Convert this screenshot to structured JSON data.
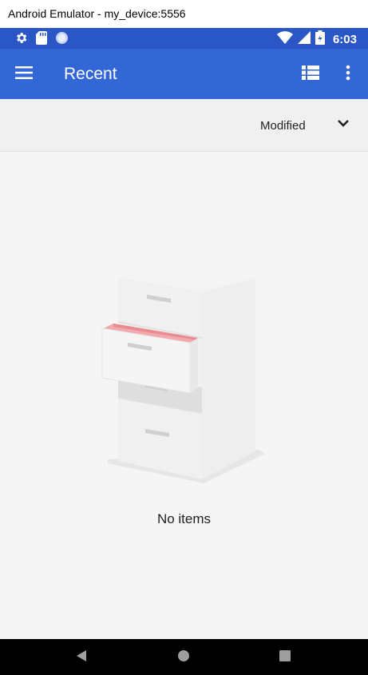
{
  "window": {
    "title": "Android Emulator - my_device:5556"
  },
  "status_bar": {
    "time": "6:03",
    "left_icons": [
      "settings-icon",
      "sd-card-icon",
      "sync-circle-icon"
    ],
    "right_icons": [
      "wifi-icon",
      "cell-signal-icon",
      "battery-icon"
    ]
  },
  "app_bar": {
    "title": "Recent",
    "background": "#3367d6",
    "status_background": "#2a56c6"
  },
  "sort": {
    "label": "Modified"
  },
  "empty_state": {
    "message": "No items"
  },
  "nav_bar": {
    "buttons": [
      "back-icon",
      "home-icon",
      "recents-icon"
    ]
  }
}
